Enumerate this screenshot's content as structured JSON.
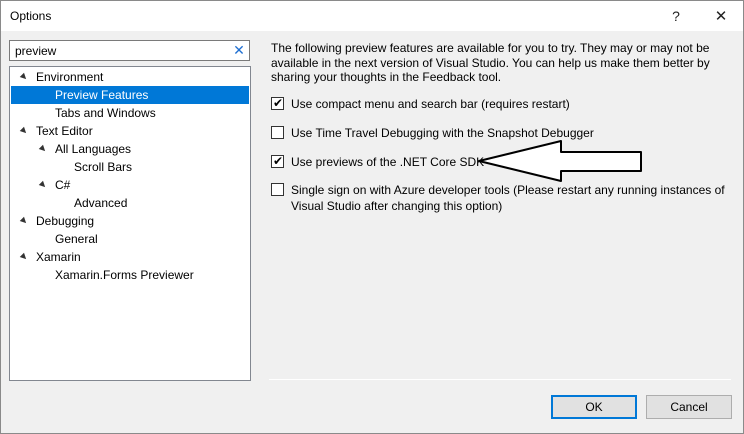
{
  "window": {
    "title": "Options",
    "help_glyph": "?",
    "close_glyph": "✕"
  },
  "search": {
    "value": "preview",
    "clear_glyph": "✕"
  },
  "tree": [
    {
      "label": "Environment",
      "expanded": true,
      "level": 0,
      "selected": false
    },
    {
      "label": "Preview Features",
      "level": 1,
      "selected": true
    },
    {
      "label": "Tabs and Windows",
      "level": 1,
      "selected": false
    },
    {
      "label": "Text Editor",
      "expanded": true,
      "level": 0,
      "selected": false
    },
    {
      "label": "All Languages",
      "expanded": true,
      "level": 1,
      "selected": false
    },
    {
      "label": "Scroll Bars",
      "level": 2,
      "selected": false
    },
    {
      "label": "C#",
      "expanded": true,
      "level": 1,
      "selected": false
    },
    {
      "label": "Advanced",
      "level": 2,
      "selected": false
    },
    {
      "label": "Debugging",
      "expanded": true,
      "level": 0,
      "selected": false
    },
    {
      "label": "General",
      "level": 1,
      "selected": false
    },
    {
      "label": "Xamarin",
      "expanded": true,
      "level": 0,
      "selected": false
    },
    {
      "label": "Xamarin.Forms Previewer",
      "level": 1,
      "selected": false
    }
  ],
  "content": {
    "description": "The following preview features are available for you to try. They may or may not be available in the next version of Visual Studio. You can help us make them better by sharing your thoughts in the Feedback tool.",
    "options": [
      {
        "label": "Use compact menu and search bar (requires restart)",
        "checked": true
      },
      {
        "label": "Use Time Travel Debugging with the Snapshot Debugger",
        "checked": false
      },
      {
        "label": "Use previews of the .NET Core SDK",
        "checked": true
      },
      {
        "label": "Single sign on with Azure developer tools (Please restart any running instances of Visual Studio after changing this option)",
        "checked": false
      }
    ]
  },
  "buttons": {
    "ok": "OK",
    "cancel": "Cancel"
  },
  "colors": {
    "selection": "#0078d7",
    "default_button_border": "#0078d7",
    "clear_icon": "#1f6fd1"
  }
}
